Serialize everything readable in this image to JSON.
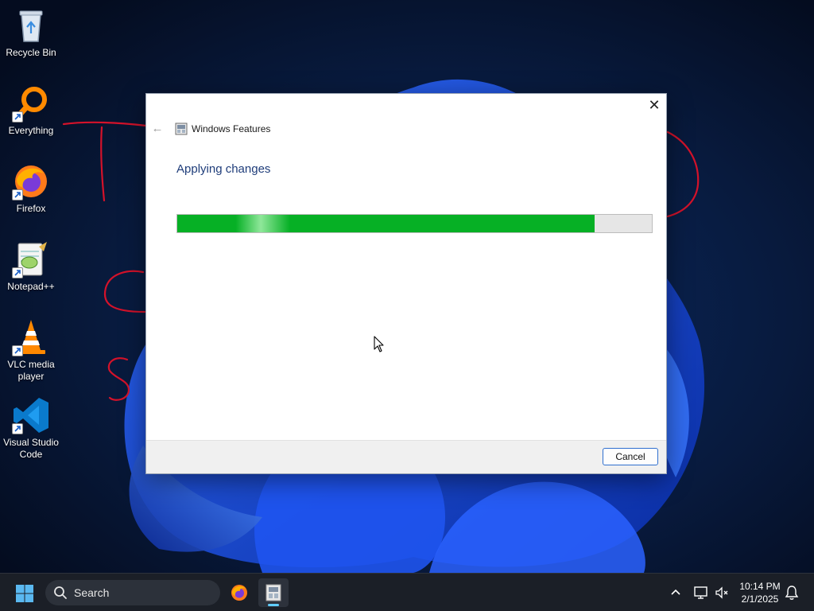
{
  "desktop": {
    "icons": [
      {
        "label": "Recycle Bin",
        "icon": "recycle-bin-icon"
      },
      {
        "label": "Everything",
        "icon": "everything-search-icon"
      },
      {
        "label": "Firefox",
        "icon": "firefox-icon"
      },
      {
        "label": "Notepad++",
        "icon": "notepad-plus-plus-icon"
      },
      {
        "label": "VLC media player",
        "icon": "vlc-cone-icon"
      },
      {
        "label": "Visual Studio Code",
        "icon": "vscode-icon"
      }
    ]
  },
  "dialog": {
    "title": "Windows Features",
    "heading": "Applying changes",
    "progress_fraction": 0.88,
    "close_glyph": "✕",
    "back_glyph": "←",
    "cancel_label": "Cancel"
  },
  "taskbar": {
    "search_label": "Search",
    "clock_time": "10:14 PM",
    "clock_date": "2/1/2025",
    "accent": "#60cdff"
  },
  "colors": {
    "progress_green": "#06b025",
    "heading_blue": "#1f3d7a",
    "annotation_red": "#d4122a"
  }
}
